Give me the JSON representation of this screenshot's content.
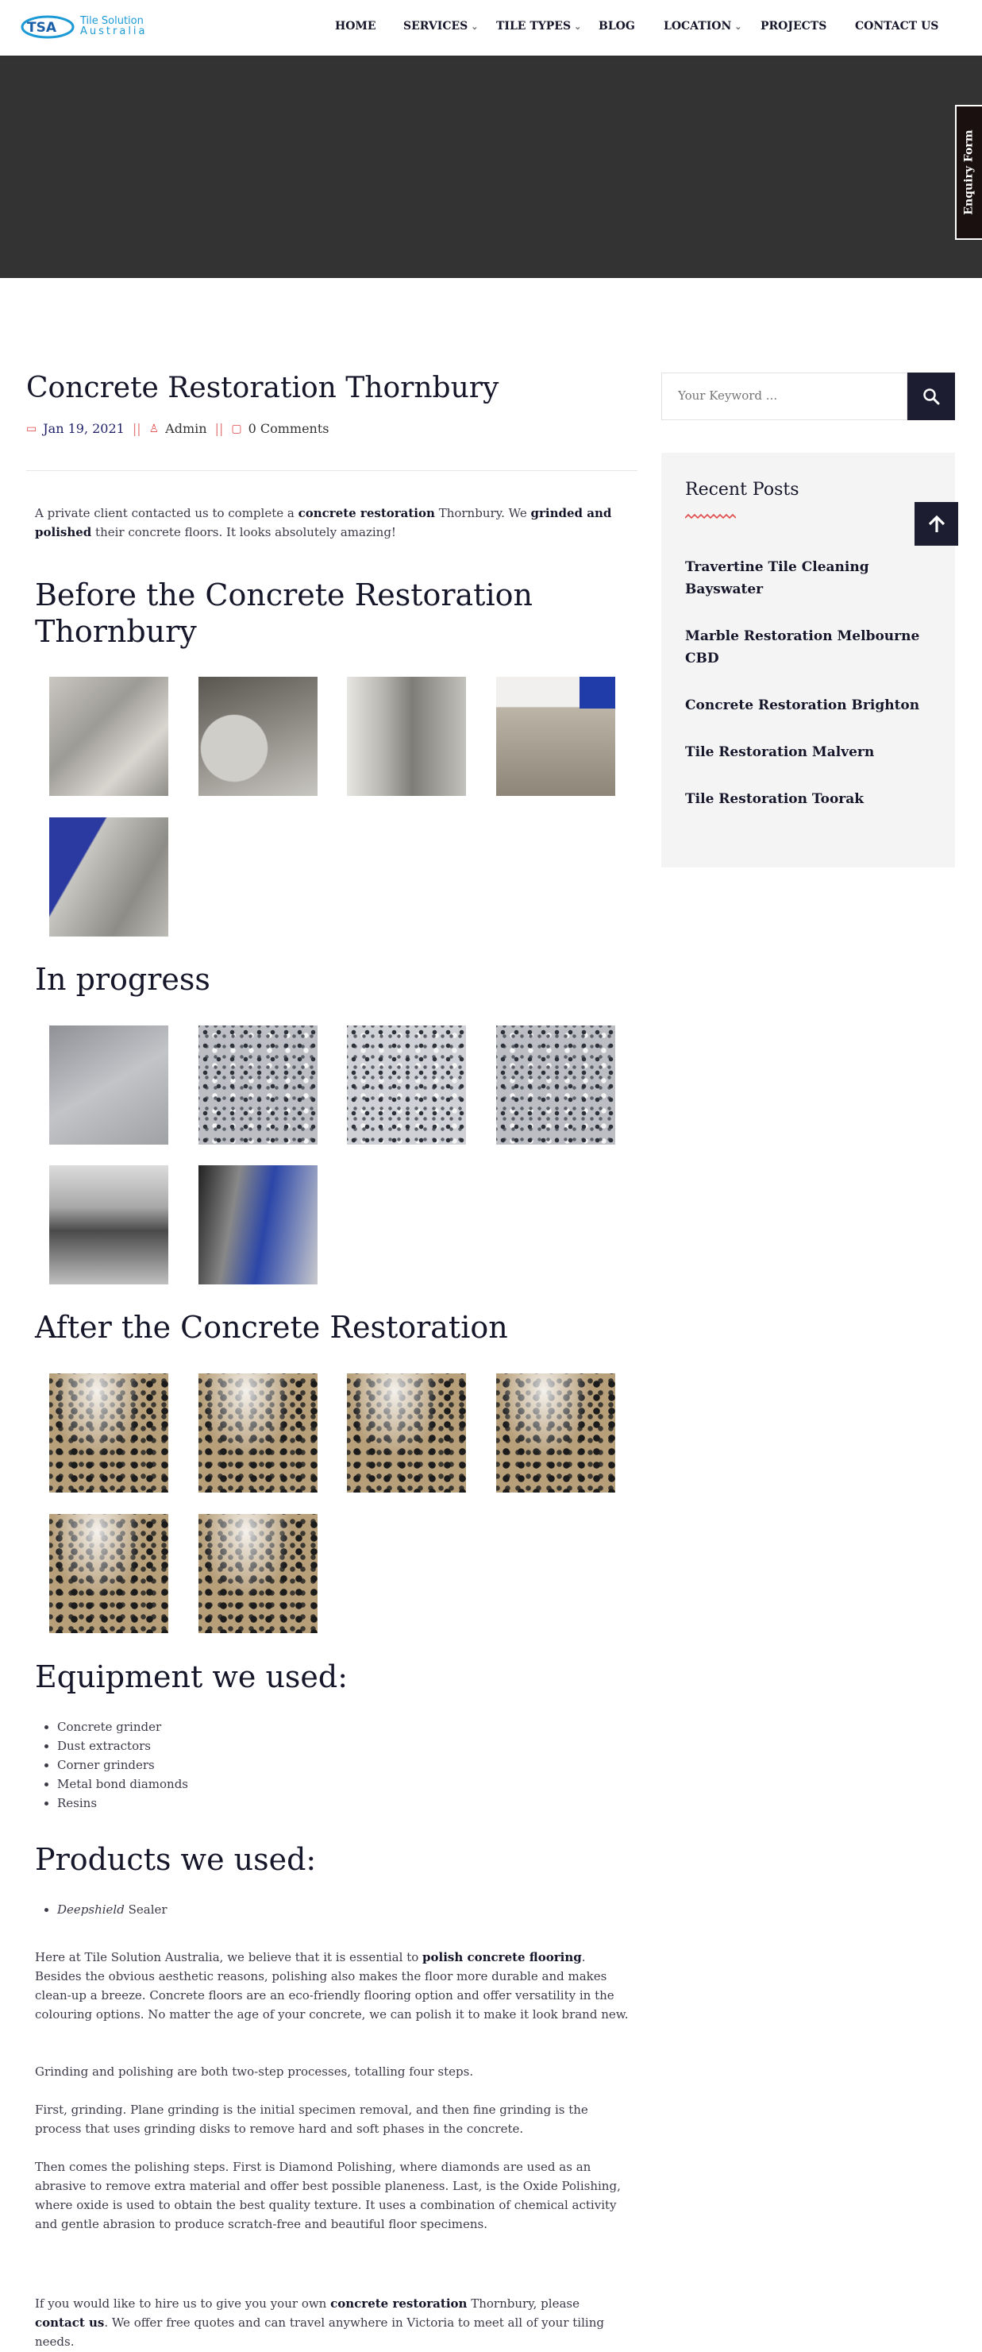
{
  "header": {
    "logo": {
      "mark": "TSA",
      "line1": "Tile Solution",
      "line2": "Australia"
    },
    "nav": [
      {
        "label": "HOME",
        "dropdown": false
      },
      {
        "label": "SERVICES",
        "dropdown": true
      },
      {
        "label": "TILE TYPES",
        "dropdown": true
      },
      {
        "label": "BLOG",
        "dropdown": false
      },
      {
        "label": "LOCATION",
        "dropdown": true
      },
      {
        "label": "PROJECTS",
        "dropdown": false
      },
      {
        "label": "CONTACT US",
        "dropdown": false
      }
    ]
  },
  "enquiry_tab": "Enquiry Form",
  "post": {
    "title": "Concrete Restoration Thornbury",
    "date": "Jan 19, 2021",
    "author": "Admin",
    "comments": "0 Comments",
    "intro": {
      "t1": "A private client contacted us to complete a ",
      "b1": "concrete restoration",
      "t2": " Thornbury. We ",
      "b2": "grinded and polished",
      "t3": " their concrete floors. It looks absolutely amazing!"
    },
    "h_before": "Before the Concrete Restoration Thornbury",
    "h_progress": "In progress",
    "h_after": "After the Concrete Restoration",
    "h_equipment": "Equipment we used:",
    "equipment": [
      "Concrete grinder",
      "Dust extractors",
      "Corner grinders",
      "Metal bond diamonds",
      "Resins"
    ],
    "h_products": "Products we used:",
    "product": {
      "italic": "Deepshield",
      "rest": " Sealer"
    },
    "p1": {
      "t1": "Here at Tile Solution Australia, we believe that it is essential to ",
      "b1": "polish concrete flooring",
      "t2": ". Besides the obvious aesthetic reasons, polishing also makes the floor more durable and makes clean-up a breeze. Concrete floors are an eco-friendly flooring option and offer versatility in the colouring options. No matter the age of your concrete, we can polish it to make it look brand new."
    },
    "p2": "Grinding and polishing are both two-step processes, totalling four steps.",
    "p3": "First, grinding. Plane grinding is the initial specimen removal, and then fine grinding is the process that uses grinding disks to remove hard and soft phases in the concrete.",
    "p4": "Then comes the polishing steps. First is Diamond Polishing, where diamonds are used as an abrasive to remove extra material and offer best possible planeness. Last, is the Oxide Polishing, where oxide is used to obtain the best quality texture. It uses a combination of chemical activity and gentle abrasion to produce scratch-free and beautiful floor specimens.",
    "p5": {
      "t1": "If you would like to hire us to give you your own ",
      "b1": "concrete restoration",
      "t2": " Thornbury, please ",
      "b2": "contact us",
      "t3": ". We offer free quotes and can travel anywhere in Victoria to meet all of your tiling needs."
    }
  },
  "sidebar": {
    "search_placeholder": "Your Keyword ...",
    "recent_title": "Recent Posts",
    "recent_posts": [
      "Travertine Tile Cleaning Bayswater",
      "Marble Restoration Melbourne CBD",
      "Concrete Restoration Brighton",
      "Tile Restoration Malvern",
      "Tile Restoration Toorak"
    ]
  },
  "colors": {
    "accent": "#e04a4a",
    "dark": "#1c1d30",
    "hero": "#333333",
    "logo": "#1b9ad6"
  },
  "icons": [
    "calendar-icon",
    "user-icon",
    "comment-icon",
    "search-icon",
    "arrow-up-icon",
    "chevron-down-icon"
  ]
}
